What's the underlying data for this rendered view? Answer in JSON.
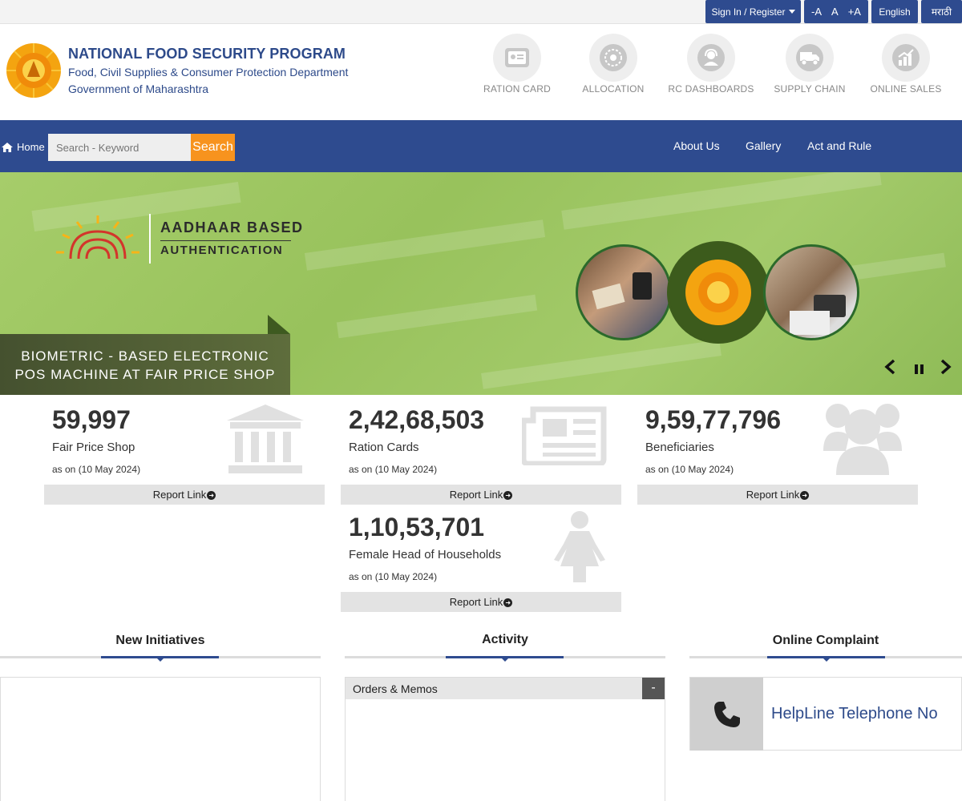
{
  "topbar": {
    "signin": "Sign In / Register",
    "font_decrease": "-A",
    "font_normal": "A",
    "font_increase": "+A",
    "lang_en": "English",
    "lang_mr": "मराठी"
  },
  "header": {
    "title": "NATIONAL FOOD SECURITY PROGRAM",
    "dept": "Food, Civil Supplies & Consumer Protection Department",
    "govt": "Government of Maharashtra",
    "quicklinks": [
      {
        "label": "RATION CARD",
        "icon": "ration-card-icon"
      },
      {
        "label": "ALLOCATION",
        "icon": "allocation-icon"
      },
      {
        "label": "RC DASHBOARDS",
        "icon": "support-agent-icon"
      },
      {
        "label": "SUPPLY CHAIN",
        "icon": "truck-icon"
      },
      {
        "label": "ONLINE SALES",
        "icon": "chart-icon"
      }
    ]
  },
  "nav": {
    "home": "Home",
    "search_placeholder": "Search - Keyword",
    "search_button": "Search",
    "links": [
      "About Us",
      "Gallery",
      "Act and Rule"
    ]
  },
  "banner": {
    "aadhaar_line1": "AADHAAR BASED",
    "aadhaar_line2": "AUTHENTICATION",
    "bio_line1": "BIOMETRIC - BASED ELECTRONIC",
    "bio_line2": "POS MACHINE AT FAIR PRICE SHOP"
  },
  "stats": [
    {
      "value": "59,997",
      "label": "Fair Price Shop",
      "ason": "as on (10 May 2024)",
      "report": "Report Link",
      "icon": "bank-building-icon"
    },
    {
      "value": "2,42,68,503",
      "label": "Ration Cards",
      "ason": "as on (10 May 2024)",
      "report": "Report Link",
      "icon": "newspaper-icon"
    },
    {
      "value": "9,59,77,796",
      "label": "Beneficiaries",
      "ason": "as on (10 May 2024)",
      "report": "Report Link",
      "icon": "users-icon"
    },
    {
      "value": "1,10,53,701",
      "label": "Female Head of Households",
      "ason": "as on (10 May 2024)",
      "report": "Report Link",
      "icon": "female-icon"
    }
  ],
  "sections": {
    "initiatives": "New Initiatives",
    "activity": "Activity",
    "complaint": "Online Complaint",
    "orders": "Orders & Memos",
    "collapse": "-",
    "helpline": "HelpLine Telephone No"
  },
  "colors": {
    "primary": "#2e4b8f",
    "accent": "#f7931e",
    "banner_green": "#a6cd6a"
  }
}
